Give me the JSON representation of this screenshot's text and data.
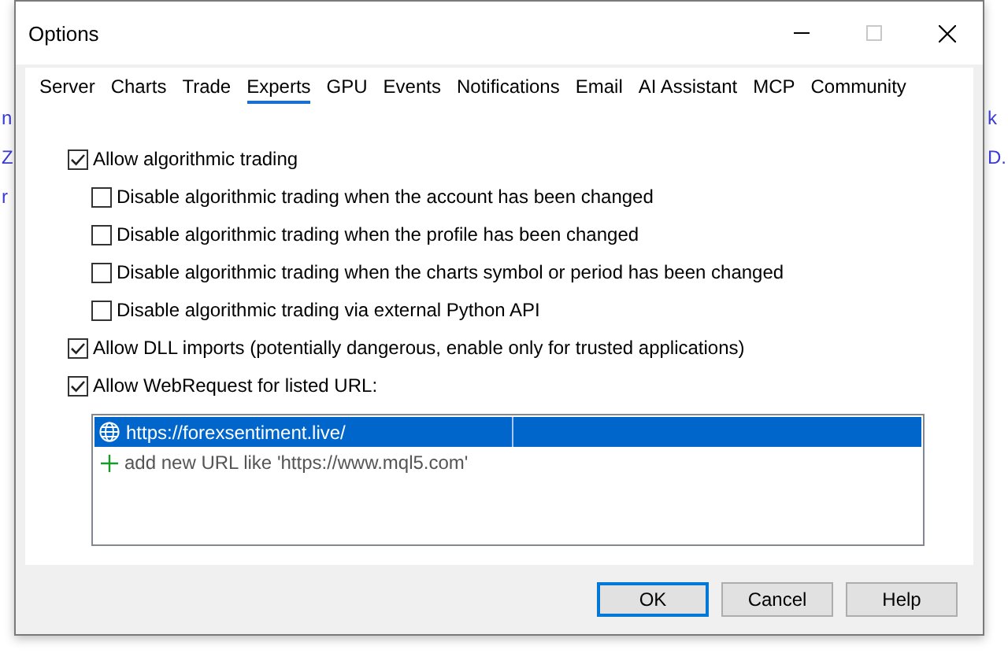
{
  "background_text": {
    "left": [
      "n",
      "Z",
      "r"
    ],
    "right": [
      "k",
      "D."
    ]
  },
  "window": {
    "title": "Options",
    "maximize_disabled": true
  },
  "tabs": [
    {
      "label": "Server",
      "selected": false
    },
    {
      "label": "Charts",
      "selected": false
    },
    {
      "label": "Trade",
      "selected": false
    },
    {
      "label": "Experts",
      "selected": true
    },
    {
      "label": "GPU",
      "selected": false
    },
    {
      "label": "Events",
      "selected": false
    },
    {
      "label": "Notifications",
      "selected": false
    },
    {
      "label": "Email",
      "selected": false
    },
    {
      "label": "AI Assistant",
      "selected": false
    },
    {
      "label": "MCP",
      "selected": false
    },
    {
      "label": "Community",
      "selected": false
    }
  ],
  "options": [
    {
      "label": "Allow algorithmic trading",
      "checked": true,
      "children": [
        {
          "label": "Disable algorithmic trading when the account has been changed",
          "checked": false
        },
        {
          "label": "Disable algorithmic trading when the profile has been changed",
          "checked": false
        },
        {
          "label": "Disable algorithmic trading when the charts symbol or period has been changed",
          "checked": false
        },
        {
          "label": "Disable algorithmic trading via external Python API",
          "checked": false
        }
      ]
    },
    {
      "label": "Allow DLL imports (potentially dangerous, enable only for trusted applications)",
      "checked": true
    },
    {
      "label": "Allow WebRequest for listed URL:",
      "checked": true
    }
  ],
  "url_list": {
    "items": [
      {
        "url": "https://forexsentiment.live/",
        "selected": true
      }
    ],
    "add_hint": "add new URL like 'https://www.mql5.com'"
  },
  "buttons": [
    {
      "label": "OK",
      "default": true
    },
    {
      "label": "Cancel",
      "default": false
    },
    {
      "label": "Help",
      "default": false
    }
  ]
}
